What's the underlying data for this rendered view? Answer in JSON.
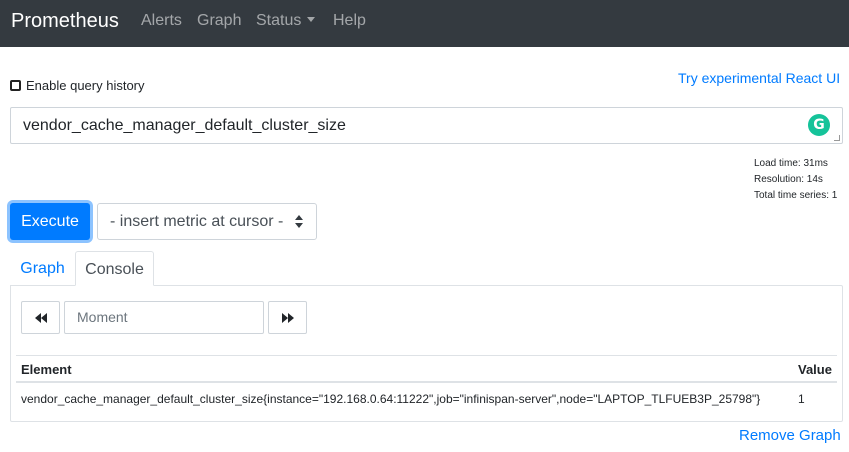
{
  "navbar": {
    "brand": "Prometheus",
    "items": [
      {
        "label": "Alerts"
      },
      {
        "label": "Graph"
      },
      {
        "label": "Status"
      },
      {
        "label": "Help"
      }
    ]
  },
  "query": {
    "history_label": "Enable query history",
    "history_checked": false,
    "react_link": "Try experimental React UI",
    "expression": "vendor_cache_manager_default_cluster_size",
    "grammarly_icon": "G"
  },
  "stats": {
    "load_time": "Load time: 31ms",
    "resolution": "Resolution: 14s",
    "total_series": "Total time series: 1"
  },
  "controls": {
    "execute_label": "Execute",
    "metric_select": "- insert metric at cursor -"
  },
  "tabs": [
    {
      "label": "Graph",
      "active": false
    },
    {
      "label": "Console",
      "active": true
    }
  ],
  "console": {
    "moment_placeholder": "Moment",
    "columns": {
      "element": "Element",
      "value": "Value"
    },
    "rows": [
      {
        "element": "vendor_cache_manager_default_cluster_size{instance=\"192.168.0.64:11222\",job=\"infinispan-server\",node=\"LAPTOP_TLFUEB3P_25798\"}",
        "value": "1"
      }
    ]
  },
  "remove_graph": "Remove Graph",
  "colors": {
    "navbar_bg": "#343a40",
    "primary": "#007bff",
    "grammarly": "#15c39a"
  }
}
